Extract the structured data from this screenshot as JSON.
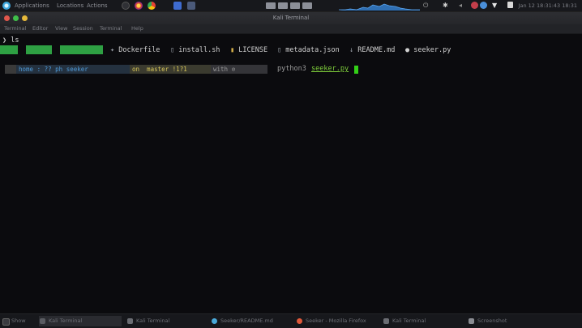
{
  "top_panel": {
    "menu": [
      "Applications",
      "Locations",
      "Actions"
    ],
    "clock": "Jan 12 18:31:43 18:31"
  },
  "window": {
    "title": "Kali Terminal",
    "menubar": [
      "Terminal",
      "Editor",
      "View",
      "Session",
      "Terminal",
      "Help"
    ]
  },
  "terminal": {
    "first_line_prompt": "❯",
    "first_line_cmd": "ls",
    "ls_files": [
      {
        "icon": "docker-icon",
        "glyph": "✦",
        "name": "Dockerfile"
      },
      {
        "icon": "shell-icon",
        "glyph": "▯",
        "name": "install.sh"
      },
      {
        "icon": "license-icon",
        "glyph": "▮",
        "name": "LICENSE"
      },
      {
        "icon": "json-icon",
        "glyph": "▯",
        "name": "metadata.json"
      },
      {
        "icon": "markdown-icon",
        "glyph": "↓",
        "name": "README.md"
      },
      {
        "icon": "python-icon",
        "glyph": "●",
        "name": "seeker.py"
      }
    ],
    "prompt": {
      "os": "",
      "path": "home : ?? ph seeker",
      "git": "on  master !1?1",
      "context": "with ⊘"
    },
    "command": "python3",
    "command_arg": "seeker.py"
  },
  "taskbar": {
    "tasks": [
      {
        "label": "Kali Terminal",
        "color": "#5a5c62",
        "active": true
      },
      {
        "label": "Kali Terminal",
        "color": "#6b6d73",
        "active": false
      },
      {
        "label": "Seeker/README.md",
        "color": "#4aa9d9",
        "active": false
      },
      {
        "label": "Seeker - Mozilla Firefox",
        "color": "#e0593b",
        "active": false
      },
      {
        "label": "Kali Terminal",
        "color": "#6b6d73",
        "active": false
      },
      {
        "label": "Screenshot",
        "color": "#8a8c92",
        "active": false
      }
    ],
    "start_label": "Show"
  },
  "colors": {
    "accent_green": "#2ea043",
    "cursor": "#33d017",
    "path_blue": "#4f9ad8",
    "git_yellow": "#d8c75a"
  }
}
